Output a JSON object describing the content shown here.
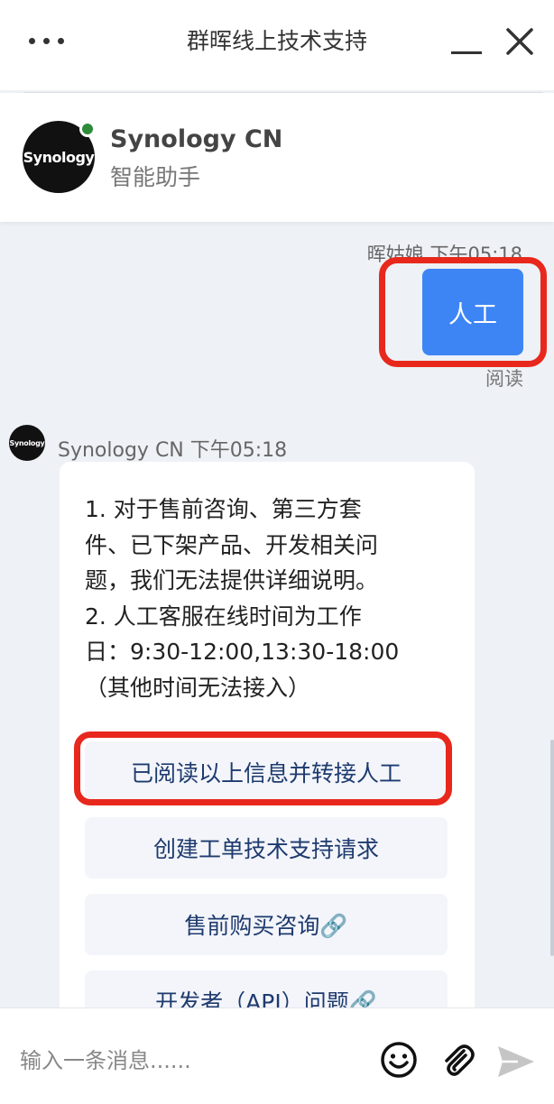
{
  "window": {
    "title": "群晖线上技术支持"
  },
  "agent": {
    "name": "Synology CN",
    "subtitle": "智能助手",
    "logo_text": "Synology"
  },
  "messages": {
    "user": {
      "meta": "晖姑娘 下午05:18",
      "text": "人工",
      "status": "阅读"
    },
    "bot": {
      "meta": "Synology CN 下午05:18",
      "lines": [
        "1. 对于售前咨询、第三方套",
        "件、已下架产品、开发相关问",
        "题，我们无法提供详细说明。",
        "2. 人工客服在线时间为工作",
        "日：9:30-12:00,13:30-18:00",
        "（其他时间无法接入）"
      ],
      "options": [
        "已阅读以上信息并转接人工",
        "创建工单技术支持请求",
        "售前购买咨询🔗",
        "开发者（API）问题🔗"
      ]
    }
  },
  "input": {
    "placeholder": "输入一条消息......"
  },
  "colors": {
    "accent": "#3d85f5",
    "highlight": "#e8281c",
    "online": "#2e8b3a"
  }
}
